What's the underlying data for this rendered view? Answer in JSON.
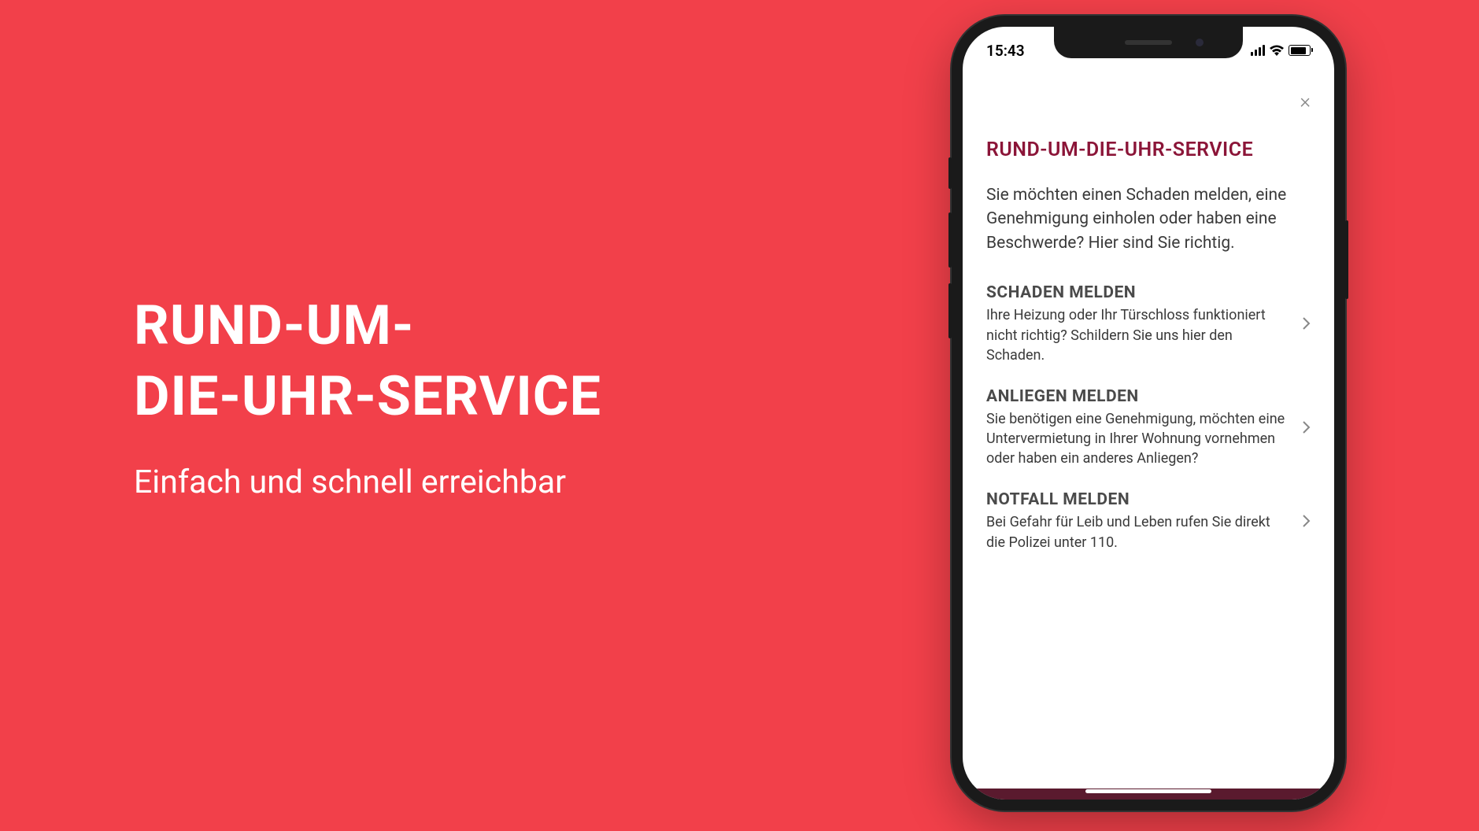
{
  "hero": {
    "title_line1": "RUND-UM-",
    "title_line2": "DIE-UHR-SERVICE",
    "subtitle": "Einfach und schnell erreichbar"
  },
  "phone": {
    "status_time": "15:43",
    "close_label": "×",
    "page_title": "RUND-UM-DIE-UHR-SERVICE",
    "page_intro": "Sie möchten einen Schaden melden, eine Genehmigung einholen oder haben eine Beschwerde? Hier sind Sie richtig.",
    "items": [
      {
        "title": "SCHADEN MELDEN",
        "desc": "Ihre Heizung oder Ihr Türschloss funktioniert nicht richtig? Schildern Sie uns hier den Schaden."
      },
      {
        "title": "ANLIEGEN MELDEN",
        "desc": "Sie benötigen eine Genehmigung, möchten eine Untervermietung in Ihrer Wohnung vornehmen oder haben ein anderes Anliegen?"
      },
      {
        "title": "NOTFALL MELDEN",
        "desc": "Bei Gefahr für Leib und Leben rufen Sie direkt die Polizei unter 110."
      }
    ]
  }
}
